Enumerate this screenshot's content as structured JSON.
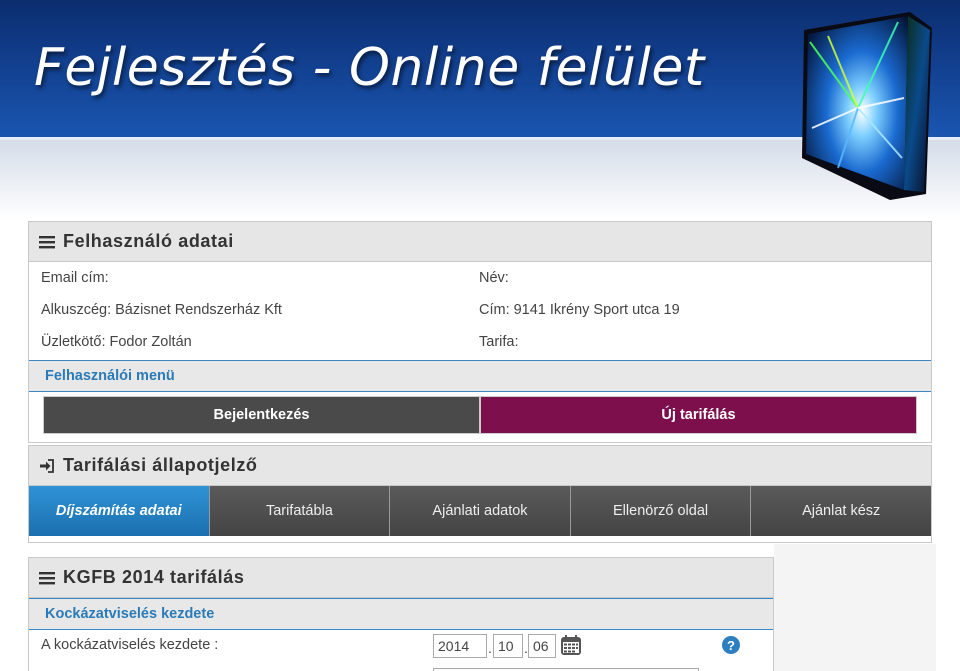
{
  "slide": {
    "title": "Fejlesztés - Online felület"
  },
  "user_panel": {
    "title": "Felhasználó adatai",
    "fields": {
      "email_label": "Email cím:",
      "email_value": "",
      "name_label": "Név:",
      "name_value": "",
      "broker_label": "Alkuszcég:",
      "broker_value": "Bázisnet Rendszerház Kft",
      "address_label": "Cím:",
      "address_value": "9141 Ikrény Sport utca 19",
      "agent_label": "Üzletkötő:",
      "agent_value": "Fodor Zoltán",
      "tariff_label": "Tarifa:",
      "tariff_value": ""
    },
    "menu_title": "Felhasználói menü",
    "menu": {
      "login_label": "Bejelentkezés",
      "new_tariff_label": "Új tarifálás"
    }
  },
  "status_panel": {
    "title": "Tarifálási állapotjelző",
    "steps": [
      "Díjszámítás adatai",
      "Tarifatábla",
      "Ajánlati adatok",
      "Ellenörző oldal",
      "Ajánlat kész"
    ],
    "active_step": 0
  },
  "kgfb_panel": {
    "title": "KGFB 2014 tarifálás",
    "section_title": "Kockázatviselés kezdete",
    "start_label": "A kockázatviselés kezdete :",
    "start_year": "2014",
    "start_month": "10",
    "start_day": "06",
    "help_symbol": "?"
  },
  "colors": {
    "accent_blue": "#2a7bb8",
    "active_step": "#1f7fc4",
    "new_tariff_button": "#7d0f4d",
    "dark_button": "#4a4a4a"
  },
  "icons": [
    "hamburger-icon",
    "sign-in-icon",
    "calendar-icon",
    "help-icon"
  ]
}
